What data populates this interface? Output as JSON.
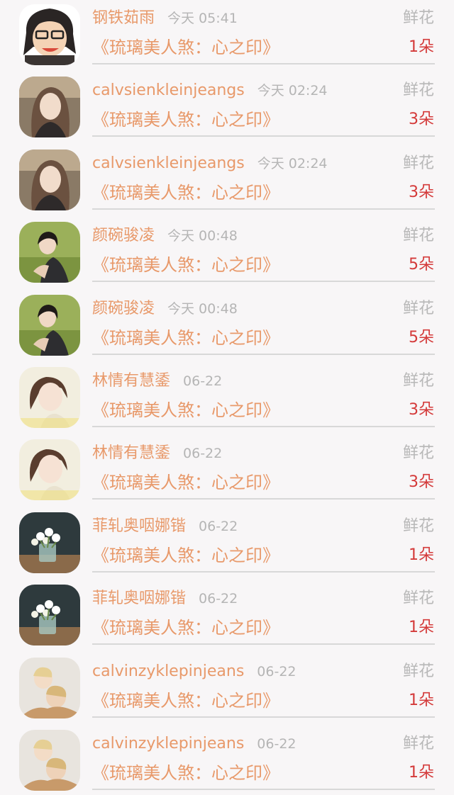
{
  "gift_label": "鲜花",
  "items": [
    {
      "name": "钢铁茹雨",
      "time": "今天 05:41",
      "book": "《琉璃美人煞：心之印》",
      "count": "1朵",
      "avatar": "cartoon"
    },
    {
      "name": "calvsienkleinjeangs",
      "time": "今天 02:24",
      "book": "《琉璃美人煞：心之印》",
      "count": "3朵",
      "avatar": "girl-longhair"
    },
    {
      "name": "calvsienkleinjeangs",
      "time": "今天 02:24",
      "book": "《琉璃美人煞：心之印》",
      "count": "3朵",
      "avatar": "girl-longhair"
    },
    {
      "name": "颜碗骏凌",
      "time": "今天 00:48",
      "book": "《琉璃美人煞：心之印》",
      "count": "5朵",
      "avatar": "girl-grass"
    },
    {
      "name": "颜碗骏凌",
      "time": "今天 00:48",
      "book": "《琉璃美人煞：心之印》",
      "count": "5朵",
      "avatar": "girl-grass"
    },
    {
      "name": "林情有慧鋈",
      "time": "06-22",
      "book": "《琉璃美人煞：心之印》",
      "count": "3朵",
      "avatar": "girl-bright"
    },
    {
      "name": "林情有慧鋈",
      "time": "06-22",
      "book": "《琉璃美人煞：心之印》",
      "count": "3朵",
      "avatar": "girl-bright"
    },
    {
      "name": "菲轧奥咽娜锴",
      "time": "06-22",
      "book": "《琉璃美人煞：心之印》",
      "count": "1朵",
      "avatar": "flowers"
    },
    {
      "name": "菲轧奥咽娜锴",
      "time": "06-22",
      "book": "《琉璃美人煞：心之印》",
      "count": "1朵",
      "avatar": "flowers"
    },
    {
      "name": "calvinzyklepinjeans",
      "time": "06-22",
      "book": "《琉璃美人煞：心之印》",
      "count": "1朵",
      "avatar": "couple"
    },
    {
      "name": "calvinzyklepinjeans",
      "time": "06-22",
      "book": "《琉璃美人煞：心之印》",
      "count": "1朵",
      "avatar": "couple"
    }
  ],
  "colors": {
    "name": "#e8996a",
    "time": "#b5b5b5",
    "count": "#d43a3a",
    "gift": "#b8b8b8",
    "background": "#f8f6f7"
  }
}
